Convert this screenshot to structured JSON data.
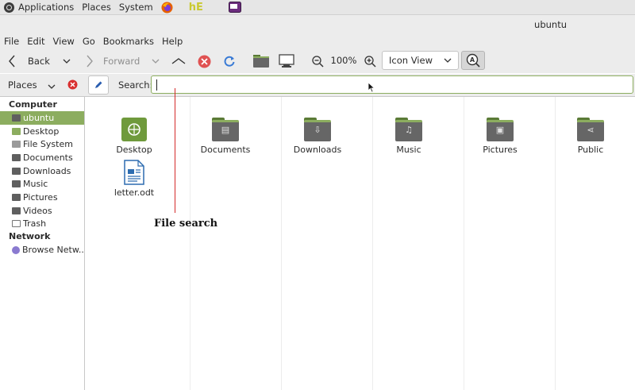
{
  "topbar": {
    "applications": "Applications",
    "places": "Places",
    "system": "System",
    "hexchat_label": "hE"
  },
  "window": {
    "title": "ubuntu"
  },
  "menu": [
    "File",
    "Edit",
    "View",
    "Go",
    "Bookmarks",
    "Help"
  ],
  "toolbar": {
    "back": "Back",
    "forward": "Forward",
    "zoom": "100%",
    "view_mode": "Icon View"
  },
  "location": {
    "places_label": "Places",
    "search_label": "Search:",
    "search_value": ""
  },
  "sidebar": {
    "computer_heading": "Computer",
    "items": [
      "ubuntu",
      "Desktop",
      "File System",
      "Documents",
      "Downloads",
      "Music",
      "Pictures",
      "Videos",
      "Trash"
    ],
    "network_heading": "Network",
    "network_items": [
      "Browse Netw..."
    ]
  },
  "files": [
    {
      "name": "Desktop",
      "icon": "desktop-folder-icon"
    },
    {
      "name": "Documents",
      "icon": "documents-folder-icon"
    },
    {
      "name": "Downloads",
      "icon": "downloads-folder-icon"
    },
    {
      "name": "Music",
      "icon": "music-folder-icon"
    },
    {
      "name": "Pictures",
      "icon": "pictures-folder-icon"
    },
    {
      "name": "Public",
      "icon": "public-folder-icon"
    },
    {
      "name": "letter.odt",
      "icon": "document-file-icon"
    }
  ],
  "annotation": {
    "label": "File search",
    "color": "#d42a2a"
  },
  "colors": {
    "accent": "#8cad5f",
    "stop": "#e05252",
    "reload": "#3a7bd5"
  }
}
